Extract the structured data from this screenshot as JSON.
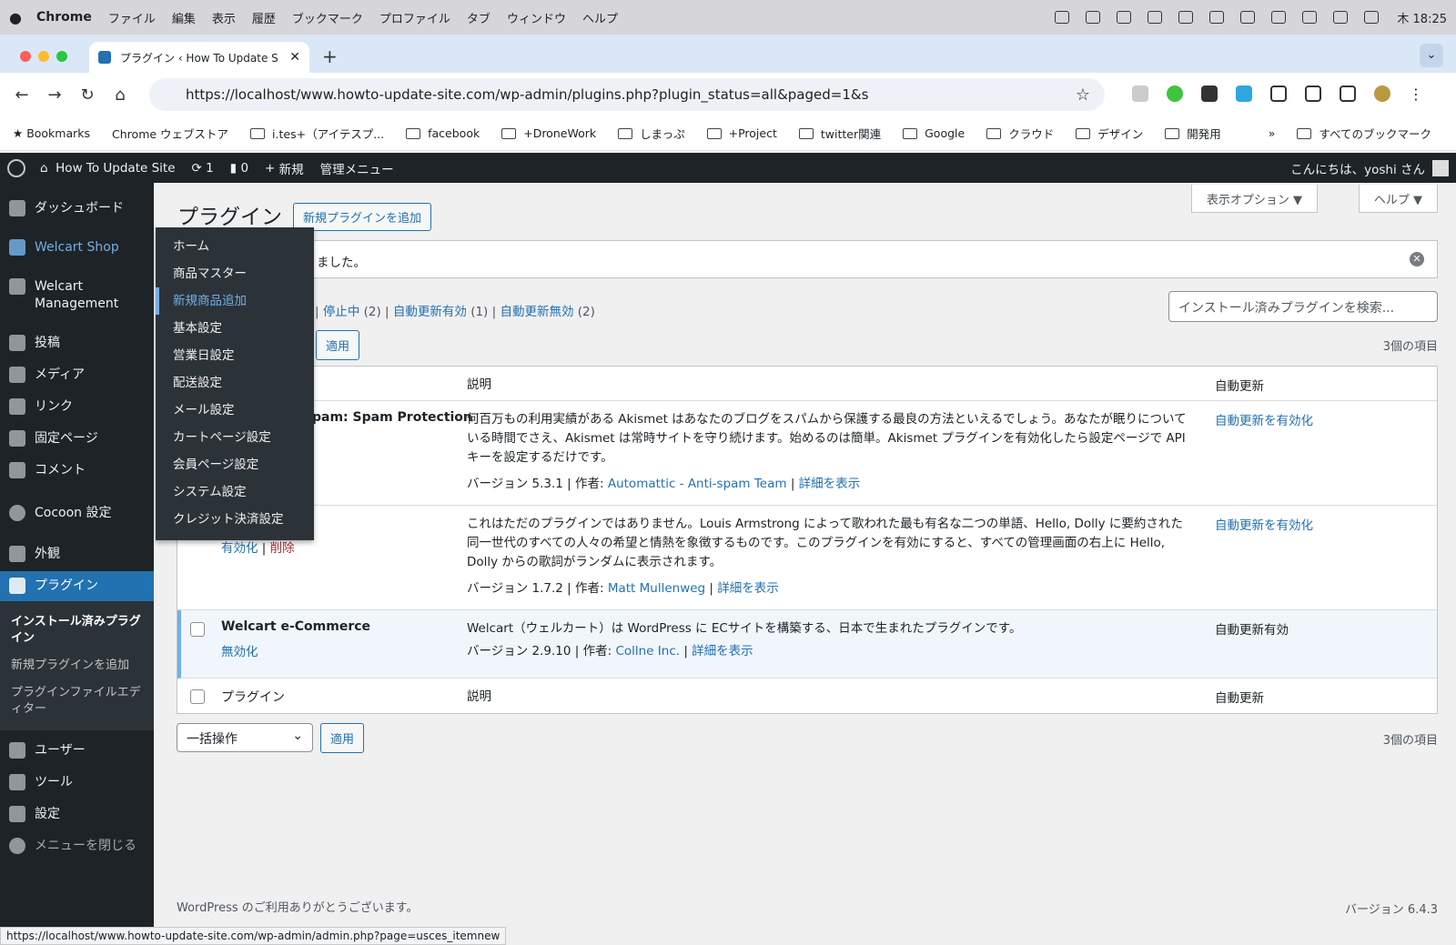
{
  "mac": {
    "app": "Chrome",
    "menus": [
      "ファイル",
      "編集",
      "表示",
      "履歴",
      "ブックマーク",
      "プロファイル",
      "タブ",
      "ウィンドウ",
      "ヘルプ"
    ],
    "clock": "木 18:25"
  },
  "tab": {
    "title": "プラグイン ‹ How To Update S"
  },
  "url": "https://localhost/www.howto-update-site.com/wp-admin/plugins.php?plugin_status=all&paged=1&s",
  "bookmarks": [
    "Bookmarks",
    "Chrome ウェブストア",
    "i.tes+（アイテスプ...",
    "facebook",
    "+DroneWork",
    "しまっぷ",
    "+Project",
    "twitter関連",
    "Google",
    "クラウド",
    "デザイン",
    "開発用"
  ],
  "all_bookmarks": "すべてのブックマーク",
  "adminbar": {
    "site": "How To Update Site",
    "updates": "1",
    "comments": "0",
    "new": "新規",
    "menu": "管理メニュー",
    "greeting": "こんにちは、yoshi さん"
  },
  "sidebar": {
    "items": [
      "ダッシュボード",
      "Welcart Shop",
      "Welcart Management",
      "投稿",
      "メディア",
      "リンク",
      "固定ページ",
      "コメント",
      "Cocoon 設定",
      "外観",
      "プラグイン"
    ],
    "sub": [
      "インストール済みプラグイン",
      "新規プラグインを追加",
      "プラグインファイルエディター"
    ],
    "items2": [
      "ユーザー",
      "ツール",
      "設定",
      "メニューを閉じる"
    ]
  },
  "flyout": [
    "ホーム",
    "商品マスター",
    "新規商品追加",
    "基本設定",
    "営業日設定",
    "配送設定",
    "メール設定",
    "カートページ設定",
    "会員ページ設定",
    "システム設定",
    "クレジット決済設定"
  ],
  "page": {
    "title": "プラグイン",
    "add_new": "新規プラグインを追加",
    "screen_options": "表示オプション ▼",
    "help": "ヘルプ ▼",
    "notice": "ました。",
    "search_placeholder": "インストール済みプラグインを検索...",
    "apply": "適用",
    "count": "3個の項目",
    "bulk": "一括操作"
  },
  "filters": {
    "inactive": "停止中",
    "inactive_count": "(2)",
    "auto_on": "自動更新有効",
    "auto_on_count": "(1)",
    "auto_off": "自動更新無効",
    "auto_off_count": "(2)"
  },
  "table": {
    "col_plugin": "プラグイン",
    "col_desc": "説明",
    "col_auto": "自動更新"
  },
  "plugins": [
    {
      "name": "pam: Spam Protection",
      "desc": "何百万もの利用実績がある Akismet はあなたのブログをスパムから保護する最良の方法といえるでしょう。あなたが眠りについている時間でさえ、Akismet は常時サイトを守り続けます。始めるのは簡単。Akismet プラグインを有効化したら設定ページで API キーを設定するだけです。",
      "version": "バージョン 5.3.1 | 作者: ",
      "author": "Automattic - Anti-spam Team",
      "details": "詳細を表示",
      "auto": "自動更新を有効化"
    },
    {
      "name": "",
      "desc": "これはただのプラグインではありません。Louis Armstrong によって歌われた最も有名な二つの単語、Hello, Dolly に要約された同一世代のすべての人々の希望と情熱を象徴するものです。このプラグインを有効にすると、すべての管理画面の右上に Hello, Dolly からの歌詞がランダムに表示されます。",
      "version": "バージョン 1.7.2 | 作者: ",
      "author": "Matt Mullenweg",
      "details": "詳細を表示",
      "auto": "自動更新を有効化",
      "activate": "有効化",
      "delete": "削除"
    },
    {
      "name": "Welcart e-Commerce",
      "desc": "Welcart（ウェルカート）は WordPress に ECサイトを構築する、日本で生まれたプラグインです。",
      "version": "バージョン 2.9.10 | 作者: ",
      "author": "Collne Inc.",
      "details": "詳細を表示",
      "auto": "自動更新有効",
      "deactivate": "無効化"
    }
  ],
  "footer": {
    "thanks": "WordPress のご利用ありがとうございます。",
    "version": "バージョン 6.4.3"
  },
  "status_url": "https://localhost/www.howto-update-site.com/wp-admin/admin.php?page=usces_itemnew"
}
